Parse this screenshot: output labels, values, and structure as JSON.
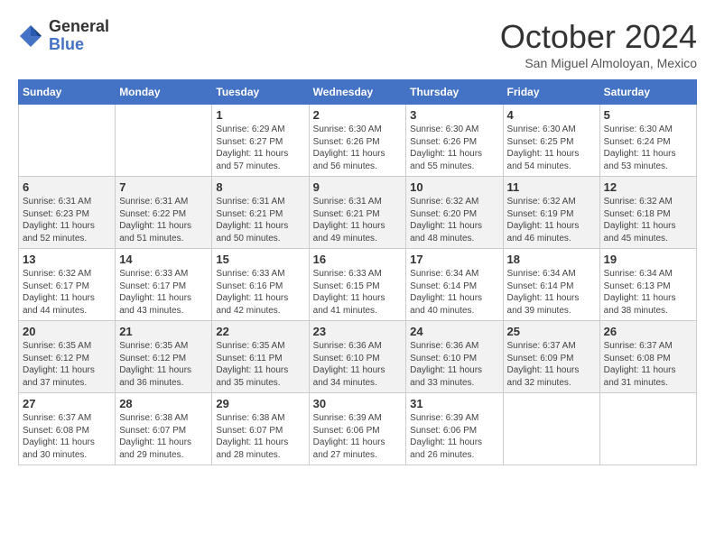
{
  "header": {
    "logo_general": "General",
    "logo_blue": "Blue",
    "month": "October 2024",
    "location": "San Miguel Almoloyan, Mexico"
  },
  "days_of_week": [
    "Sunday",
    "Monday",
    "Tuesday",
    "Wednesday",
    "Thursday",
    "Friday",
    "Saturday"
  ],
  "weeks": [
    [
      {
        "day": "",
        "sunrise": "",
        "sunset": "",
        "daylight": ""
      },
      {
        "day": "",
        "sunrise": "",
        "sunset": "",
        "daylight": ""
      },
      {
        "day": "1",
        "sunrise": "Sunrise: 6:29 AM",
        "sunset": "Sunset: 6:27 PM",
        "daylight": "Daylight: 11 hours and 57 minutes."
      },
      {
        "day": "2",
        "sunrise": "Sunrise: 6:30 AM",
        "sunset": "Sunset: 6:26 PM",
        "daylight": "Daylight: 11 hours and 56 minutes."
      },
      {
        "day": "3",
        "sunrise": "Sunrise: 6:30 AM",
        "sunset": "Sunset: 6:26 PM",
        "daylight": "Daylight: 11 hours and 55 minutes."
      },
      {
        "day": "4",
        "sunrise": "Sunrise: 6:30 AM",
        "sunset": "Sunset: 6:25 PM",
        "daylight": "Daylight: 11 hours and 54 minutes."
      },
      {
        "day": "5",
        "sunrise": "Sunrise: 6:30 AM",
        "sunset": "Sunset: 6:24 PM",
        "daylight": "Daylight: 11 hours and 53 minutes."
      }
    ],
    [
      {
        "day": "6",
        "sunrise": "Sunrise: 6:31 AM",
        "sunset": "Sunset: 6:23 PM",
        "daylight": "Daylight: 11 hours and 52 minutes."
      },
      {
        "day": "7",
        "sunrise": "Sunrise: 6:31 AM",
        "sunset": "Sunset: 6:22 PM",
        "daylight": "Daylight: 11 hours and 51 minutes."
      },
      {
        "day": "8",
        "sunrise": "Sunrise: 6:31 AM",
        "sunset": "Sunset: 6:21 PM",
        "daylight": "Daylight: 11 hours and 50 minutes."
      },
      {
        "day": "9",
        "sunrise": "Sunrise: 6:31 AM",
        "sunset": "Sunset: 6:21 PM",
        "daylight": "Daylight: 11 hours and 49 minutes."
      },
      {
        "day": "10",
        "sunrise": "Sunrise: 6:32 AM",
        "sunset": "Sunset: 6:20 PM",
        "daylight": "Daylight: 11 hours and 48 minutes."
      },
      {
        "day": "11",
        "sunrise": "Sunrise: 6:32 AM",
        "sunset": "Sunset: 6:19 PM",
        "daylight": "Daylight: 11 hours and 46 minutes."
      },
      {
        "day": "12",
        "sunrise": "Sunrise: 6:32 AM",
        "sunset": "Sunset: 6:18 PM",
        "daylight": "Daylight: 11 hours and 45 minutes."
      }
    ],
    [
      {
        "day": "13",
        "sunrise": "Sunrise: 6:32 AM",
        "sunset": "Sunset: 6:17 PM",
        "daylight": "Daylight: 11 hours and 44 minutes."
      },
      {
        "day": "14",
        "sunrise": "Sunrise: 6:33 AM",
        "sunset": "Sunset: 6:17 PM",
        "daylight": "Daylight: 11 hours and 43 minutes."
      },
      {
        "day": "15",
        "sunrise": "Sunrise: 6:33 AM",
        "sunset": "Sunset: 6:16 PM",
        "daylight": "Daylight: 11 hours and 42 minutes."
      },
      {
        "day": "16",
        "sunrise": "Sunrise: 6:33 AM",
        "sunset": "Sunset: 6:15 PM",
        "daylight": "Daylight: 11 hours and 41 minutes."
      },
      {
        "day": "17",
        "sunrise": "Sunrise: 6:34 AM",
        "sunset": "Sunset: 6:14 PM",
        "daylight": "Daylight: 11 hours and 40 minutes."
      },
      {
        "day": "18",
        "sunrise": "Sunrise: 6:34 AM",
        "sunset": "Sunset: 6:14 PM",
        "daylight": "Daylight: 11 hours and 39 minutes."
      },
      {
        "day": "19",
        "sunrise": "Sunrise: 6:34 AM",
        "sunset": "Sunset: 6:13 PM",
        "daylight": "Daylight: 11 hours and 38 minutes."
      }
    ],
    [
      {
        "day": "20",
        "sunrise": "Sunrise: 6:35 AM",
        "sunset": "Sunset: 6:12 PM",
        "daylight": "Daylight: 11 hours and 37 minutes."
      },
      {
        "day": "21",
        "sunrise": "Sunrise: 6:35 AM",
        "sunset": "Sunset: 6:12 PM",
        "daylight": "Daylight: 11 hours and 36 minutes."
      },
      {
        "day": "22",
        "sunrise": "Sunrise: 6:35 AM",
        "sunset": "Sunset: 6:11 PM",
        "daylight": "Daylight: 11 hours and 35 minutes."
      },
      {
        "day": "23",
        "sunrise": "Sunrise: 6:36 AM",
        "sunset": "Sunset: 6:10 PM",
        "daylight": "Daylight: 11 hours and 34 minutes."
      },
      {
        "day": "24",
        "sunrise": "Sunrise: 6:36 AM",
        "sunset": "Sunset: 6:10 PM",
        "daylight": "Daylight: 11 hours and 33 minutes."
      },
      {
        "day": "25",
        "sunrise": "Sunrise: 6:37 AM",
        "sunset": "Sunset: 6:09 PM",
        "daylight": "Daylight: 11 hours and 32 minutes."
      },
      {
        "day": "26",
        "sunrise": "Sunrise: 6:37 AM",
        "sunset": "Sunset: 6:08 PM",
        "daylight": "Daylight: 11 hours and 31 minutes."
      }
    ],
    [
      {
        "day": "27",
        "sunrise": "Sunrise: 6:37 AM",
        "sunset": "Sunset: 6:08 PM",
        "daylight": "Daylight: 11 hours and 30 minutes."
      },
      {
        "day": "28",
        "sunrise": "Sunrise: 6:38 AM",
        "sunset": "Sunset: 6:07 PM",
        "daylight": "Daylight: 11 hours and 29 minutes."
      },
      {
        "day": "29",
        "sunrise": "Sunrise: 6:38 AM",
        "sunset": "Sunset: 6:07 PM",
        "daylight": "Daylight: 11 hours and 28 minutes."
      },
      {
        "day": "30",
        "sunrise": "Sunrise: 6:39 AM",
        "sunset": "Sunset: 6:06 PM",
        "daylight": "Daylight: 11 hours and 27 minutes."
      },
      {
        "day": "31",
        "sunrise": "Sunrise: 6:39 AM",
        "sunset": "Sunset: 6:06 PM",
        "daylight": "Daylight: 11 hours and 26 minutes."
      },
      {
        "day": "",
        "sunrise": "",
        "sunset": "",
        "daylight": ""
      },
      {
        "day": "",
        "sunrise": "",
        "sunset": "",
        "daylight": ""
      }
    ]
  ]
}
